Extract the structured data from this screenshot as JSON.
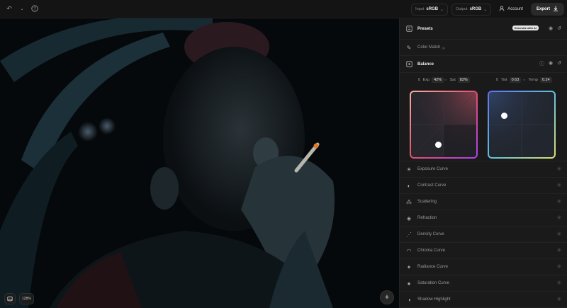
{
  "topbar": {
    "input_label": "Input",
    "input_value": "sRGB",
    "output_label": "Output",
    "output_value": "sRGB",
    "account_label": "Account",
    "export_label": "Export"
  },
  "canvas": {
    "zoom_level": "128%",
    "add_label": "+"
  },
  "panel": {
    "presets": {
      "label": "Presets",
      "badge": "Generate with AI"
    },
    "color_match": {
      "label": "Color Match",
      "sup": "(1)"
    },
    "balance": {
      "label": "Balance",
      "exp_label": "Exp",
      "exp_value": "42%",
      "sat_label": "Sat",
      "sat_value": "82%",
      "tint_label": "Tint",
      "tint_value": "0.63",
      "temp_label": "Temp",
      "temp_value": "0.24"
    },
    "items": [
      {
        "label": "Exposure Curve",
        "icon": "sun-icon"
      },
      {
        "label": "Contrast Curve",
        "icon": "contrast-icon"
      },
      {
        "label": "Scattering",
        "icon": "scatter-icon"
      },
      {
        "label": "Refraction",
        "icon": "refraction-icon"
      },
      {
        "label": "Density Curve",
        "icon": "density-icon"
      },
      {
        "label": "Chroma Curve",
        "icon": "chroma-icon"
      },
      {
        "label": "Radiance Curve",
        "icon": "radiance-icon"
      },
      {
        "label": "Saturation Curve",
        "icon": "drop-icon"
      },
      {
        "label": "Shadow Highlight",
        "icon": "shadow-icon"
      }
    ]
  }
}
